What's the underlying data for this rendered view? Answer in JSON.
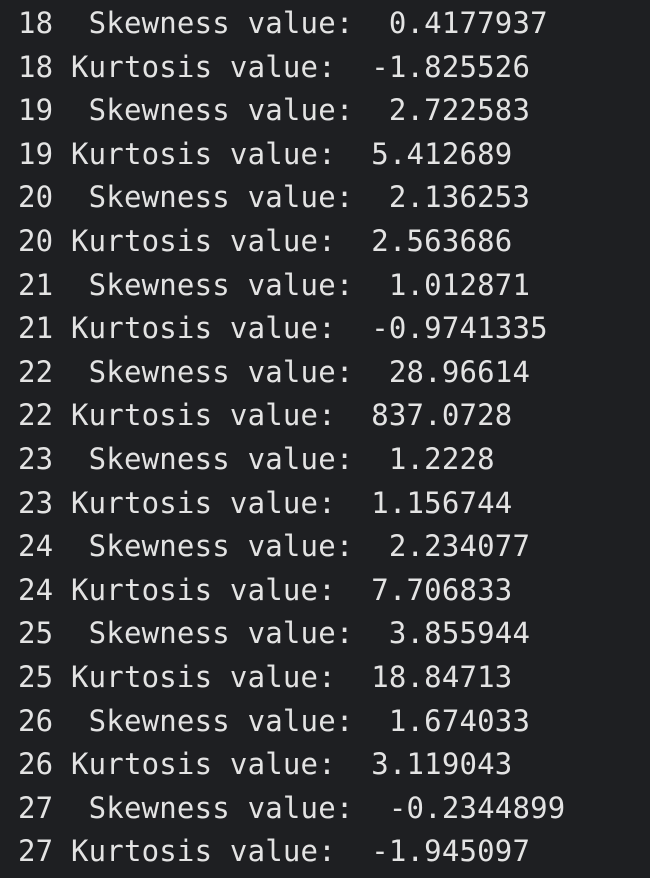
{
  "console": {
    "lines": [
      "18  Skewness value:  0.4177937",
      "18 Kurtosis value:  -1.825526",
      "19  Skewness value:  2.722583",
      "19 Kurtosis value:  5.412689",
      "20  Skewness value:  2.136253",
      "20 Kurtosis value:  2.563686",
      "21  Skewness value:  1.012871",
      "21 Kurtosis value:  -0.9741335",
      "22  Skewness value:  28.96614",
      "22 Kurtosis value:  837.0728",
      "23  Skewness value:  1.2228",
      "23 Kurtosis value:  1.156744",
      "24  Skewness value:  2.234077",
      "24 Kurtosis value:  7.706833",
      "25  Skewness value:  3.855944",
      "25 Kurtosis value:  18.84713",
      "26  Skewness value:  1.674033",
      "26 Kurtosis value:  3.119043",
      "27  Skewness value:  -0.2344899",
      "27 Kurtosis value:  -1.945097"
    ]
  },
  "colors": {
    "background": "#1e1f22",
    "text": "#e3e3e3"
  }
}
